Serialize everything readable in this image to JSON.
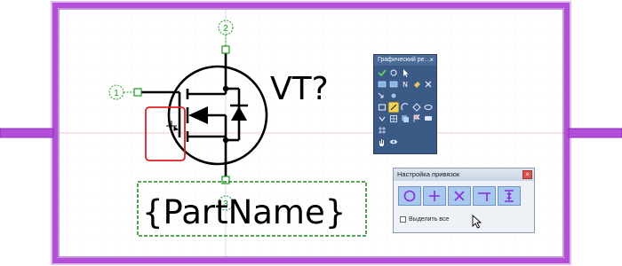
{
  "canvas": {
    "component_ref": "VT?",
    "part_name_placeholder": "{PartName}",
    "pin_numbers": [
      "1",
      "2",
      "3"
    ]
  },
  "graphics_palette": {
    "title": "Графический ре…",
    "close_glyph": "×",
    "tools": [
      {
        "icon": "check-icon"
      },
      {
        "icon": "refresh-icon"
      },
      {
        "icon": "pointer-icon"
      },
      {
        "icon": "blank-icon"
      },
      {
        "icon": "blank-icon"
      },
      {
        "icon": "image-icon"
      },
      {
        "icon": "image-icon"
      },
      {
        "icon": "text-n-icon"
      },
      {
        "icon": "fill-icon"
      },
      {
        "icon": "tool-icon"
      },
      {
        "icon": "arrow-icon"
      },
      {
        "icon": "node-icon"
      },
      {
        "icon": "blank-icon"
      },
      {
        "icon": "blank-icon"
      },
      {
        "icon": "blank-icon"
      },
      {
        "icon": "rectangle-icon"
      },
      {
        "icon": "line-icon"
      },
      {
        "icon": "arc-icon"
      },
      {
        "icon": "polygon-icon"
      },
      {
        "icon": "ellipse-icon"
      },
      {
        "icon": "text-icon"
      },
      {
        "icon": "table-icon"
      },
      {
        "icon": "copy-icon"
      },
      {
        "icon": "flag-icon"
      },
      {
        "icon": "chat-icon"
      },
      {
        "icon": "grid-icon"
      },
      {
        "icon": "blank-icon"
      },
      {
        "icon": "blank-icon"
      },
      {
        "icon": "blank-icon"
      },
      {
        "icon": "blank-icon"
      },
      {
        "icon": "hand-icon"
      },
      {
        "icon": "eye-icon"
      },
      {
        "icon": "blank-icon"
      },
      {
        "icon": "blank-icon"
      },
      {
        "icon": "blank-icon"
      }
    ],
    "selected_tool": "line-icon"
  },
  "snap_settings": {
    "title": "Настройка привязок",
    "close_glyph": "×",
    "buttons": [
      {
        "name": "snap-center",
        "icon": "circle-snap-icon"
      },
      {
        "name": "snap-cross",
        "icon": "plus-snap-icon"
      },
      {
        "name": "snap-intersection",
        "icon": "x-snap-icon"
      },
      {
        "name": "snap-perpendicular",
        "icon": "tee-snap-icon"
      },
      {
        "name": "snap-midpoint",
        "icon": "mid-snap-icon"
      }
    ],
    "select_all_label": "Выделить все",
    "select_all_checked": false
  },
  "colors": {
    "frame": "#b24ed8",
    "grid": "#c9c9ef",
    "pin_label": "#1f9a1f",
    "selection": "#e02020",
    "symbol": "#000000"
  }
}
